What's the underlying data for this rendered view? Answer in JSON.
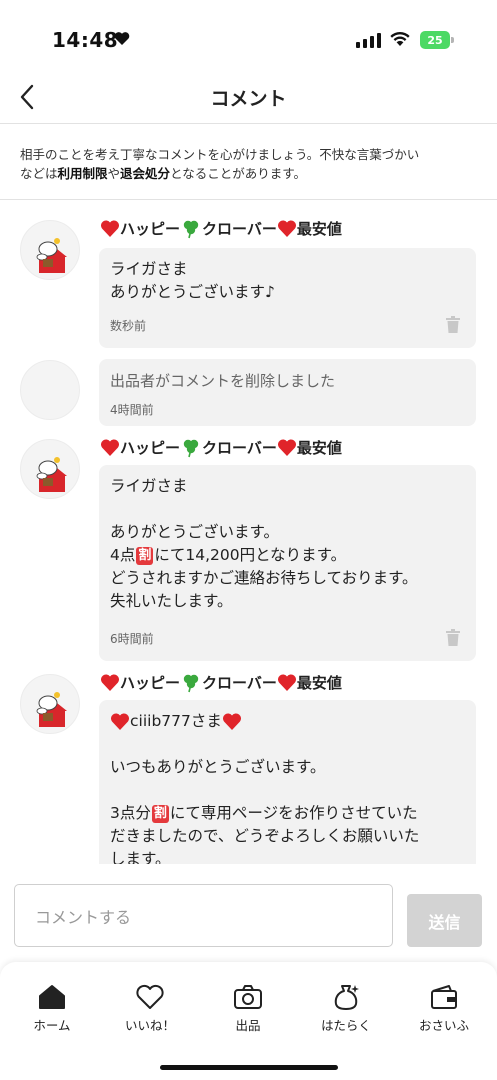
{
  "status_bar": {
    "time": "14:48",
    "battery": "25"
  },
  "header": {
    "title": "コメント"
  },
  "notice": {
    "line1": "相手のことを考え丁寧なコメントを心がけましょう。不快な言葉づかい",
    "line2_a": "などは",
    "line2_b": "利用制限",
    "line2_c": "や",
    "line2_d": "退会処分",
    "line2_e": "となることがあります。"
  },
  "comments": [
    {
      "name_a": "ハッピー",
      "name_b": "クローバー",
      "name_c": "最安値",
      "text": "ライガさま\nありがとうございます♪",
      "time": "数秒前"
    },
    {
      "deleted_text": "出品者がコメントを削除しました",
      "time": "4時間前"
    },
    {
      "name_a": "ハッピー",
      "name_b": "クローバー",
      "name_c": "最安値",
      "line1": "ライガさま",
      "line3": "ありがとうございます。",
      "line4_a": "4点",
      "line4_k": "割",
      "line4_b": "にて14,200円となります。",
      "line5": "どうされますかご連絡お待ちしております。",
      "line6": "失礼いたします。",
      "time": "6時間前"
    },
    {
      "name_a": "ハッピー",
      "name_b": "クローバー",
      "name_c": "最安値",
      "line1": "ciiib777さま",
      "line3": "いつもありがとうございます。",
      "line5_a": "3点分",
      "line5_k": "割",
      "line5_b": "にて専用ページをお作りさせていた",
      "line6": "だきましたので、どうぞよろしくお願いいた",
      "line7": "します。"
    }
  ],
  "input": {
    "placeholder": "コメントする",
    "send_label": "送信"
  },
  "tabs": [
    {
      "label": "ホーム",
      "icon": "home-icon"
    },
    {
      "label": "いいね！",
      "icon": "heart-icon"
    },
    {
      "label": "出品",
      "icon": "camera-icon"
    },
    {
      "label": "はたらく",
      "icon": "money-bag-icon"
    },
    {
      "label": "おさいふ",
      "icon": "wallet-icon"
    }
  ],
  "colors": {
    "heart": "#e0242a",
    "clover": "#3aa93e",
    "kanji_box": "#e4393c",
    "battery": "#4cd964"
  }
}
